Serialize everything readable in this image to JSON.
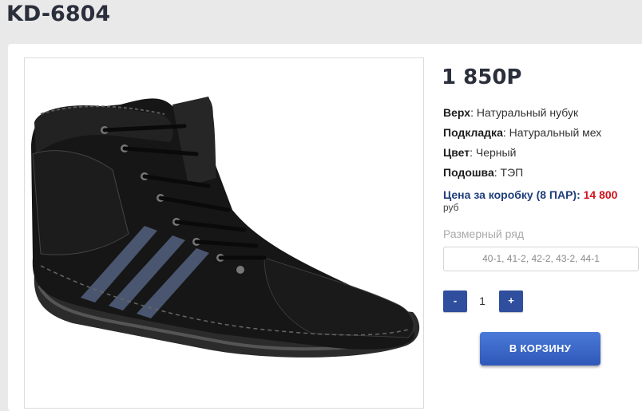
{
  "product": {
    "title": "KD-6804",
    "price": "1 850Р"
  },
  "attributes": [
    {
      "key": "Верх",
      "value": "Натуральный нубук"
    },
    {
      "key": "Подкладка",
      "value": "Натуральный мех"
    },
    {
      "key": "Цвет",
      "value": "Черный"
    },
    {
      "key": "Подошва",
      "value": "ТЭП"
    }
  ],
  "box_price": {
    "label": "Цена за коробку (8 ПАР):",
    "value": "14 800",
    "unit": "руб"
  },
  "sizes": {
    "label": "Размерный ряд",
    "value": "40-1, 41-2, 42-2, 43-2, 44-1"
  },
  "quantity": {
    "minus_label": "-",
    "plus_label": "+",
    "value": "1"
  },
  "cart_button": {
    "label": "В КОРЗИНУ"
  },
  "colors": {
    "accent": "#2f4f9e",
    "price_red": "#d0121b",
    "title": "#2a2f3b"
  }
}
